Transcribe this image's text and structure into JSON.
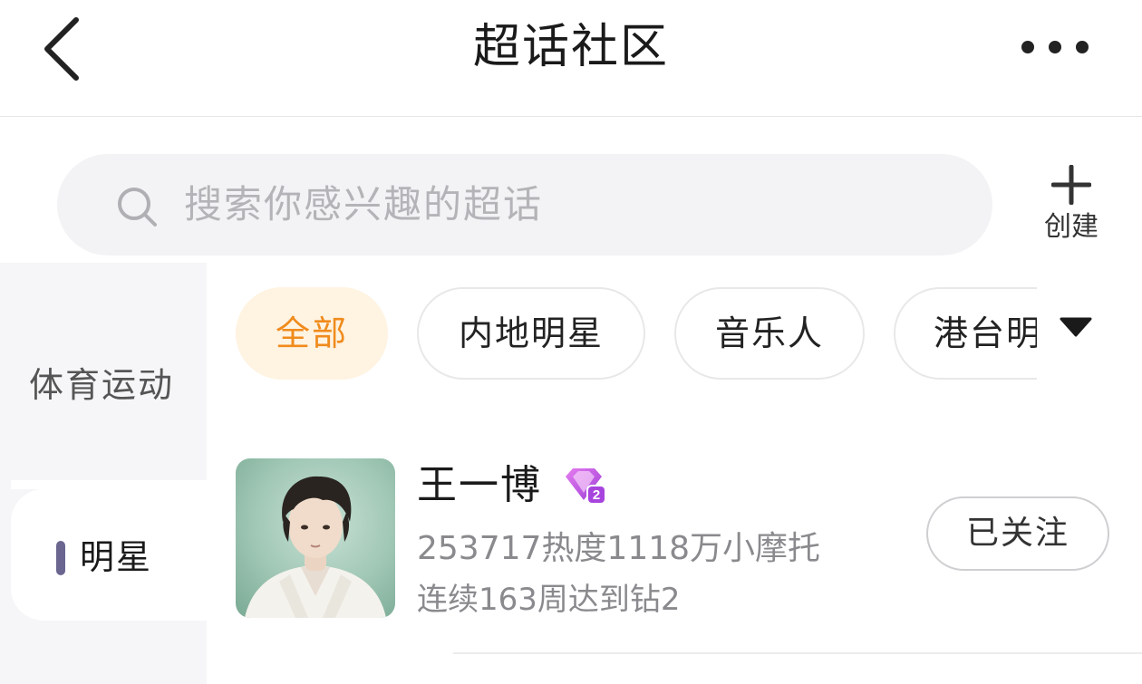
{
  "header": {
    "title": "超话社区",
    "back_icon": "chevron-left-icon",
    "more_icon": "more-horizontal-icon"
  },
  "search": {
    "placeholder": "搜索你感兴趣的超话",
    "icon": "search-icon"
  },
  "create": {
    "label": "创建",
    "icon": "plus-icon"
  },
  "categories": [
    {
      "label": "体育运动",
      "selected": false
    },
    {
      "label": "明星",
      "selected": true
    }
  ],
  "chips": [
    {
      "label": "全部",
      "active": true
    },
    {
      "label": "内地明星",
      "active": false
    },
    {
      "label": "音乐人",
      "active": false
    },
    {
      "label": "港台明",
      "active": false
    }
  ],
  "chips_expand_icon": "triangle-down-icon",
  "topics": [
    {
      "name": "王一博",
      "badge_icon": "diamond-level-2-icon",
      "stats": "253717热度1118万小摩托",
      "streak": "连续163周达到钻2",
      "follow_label": "已关注"
    }
  ],
  "colors": {
    "accent": "#f08b1c",
    "chip_active_bg": "#fff3e2",
    "indicator": "#6a6690",
    "muted_text": "#8a8a8e",
    "badge": "#c04ee0"
  }
}
